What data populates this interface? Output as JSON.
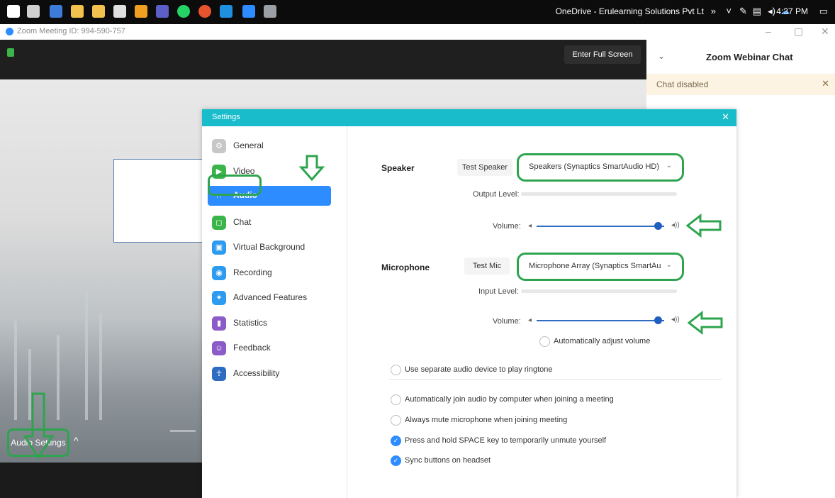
{
  "taskbar": {
    "tray_text": "OneDrive - Erulearning Solutions Pvt Lt",
    "time": "4:37 PM"
  },
  "window": {
    "title": "Zoom Meeting ID: 994-590-757"
  },
  "meeting": {
    "fullscreen_label": "Enter Full Screen",
    "audio_settings_label": "Audio Settings"
  },
  "chat": {
    "title": "Zoom Webinar Chat",
    "disabled_text": "Chat disabled"
  },
  "settings": {
    "title": "Settings",
    "nav": [
      {
        "label": "General",
        "color": "#c7c7c7"
      },
      {
        "label": "Video",
        "color": "#3bb54a"
      },
      {
        "label": "Audio",
        "color": "#2d8cff"
      },
      {
        "label": "Chat",
        "color": "#3bb54a"
      },
      {
        "label": "Virtual Background",
        "color": "#2d9bf0"
      },
      {
        "label": "Recording",
        "color": "#2d9bf0"
      },
      {
        "label": "Advanced Features",
        "color": "#2d9bf0"
      },
      {
        "label": "Statistics",
        "color": "#8b5cc7"
      },
      {
        "label": "Feedback",
        "color": "#8b5cc7"
      },
      {
        "label": "Accessibility",
        "color": "#2d6cc0"
      }
    ],
    "speaker": {
      "label": "Speaker",
      "test_button": "Test Speaker",
      "device": "Speakers (Synaptics SmartAudio HD)",
      "output_level_label": "Output Level:",
      "volume_label": "Volume:",
      "volume_level": 0.95
    },
    "microphone": {
      "label": "Microphone",
      "test_button": "Test Mic",
      "device": "Microphone Array (Synaptics SmartAu",
      "input_level_label": "Input Level:",
      "volume_label": "Volume:",
      "volume_level": 0.95,
      "auto_adjust_label": "Automatically adjust volume"
    },
    "options": {
      "separate_ringtone": "Use separate audio device to play ringtone",
      "auto_join": "Automatically join audio by computer when joining a meeting",
      "always_mute": "Always mute microphone when joining meeting",
      "space_unmute": "Press and hold SPACE key to temporarily unmute yourself",
      "sync_headset": "Sync buttons on headset"
    },
    "checks": {
      "auto_adjust": false,
      "separate_ringtone": false,
      "auto_join": false,
      "always_mute": false,
      "space_unmute": true,
      "sync_headset": true
    }
  },
  "colors": {
    "highlight_green": "#2ea44f",
    "zoom_blue": "#2d8cff",
    "settings_bar": "#19bccb"
  }
}
